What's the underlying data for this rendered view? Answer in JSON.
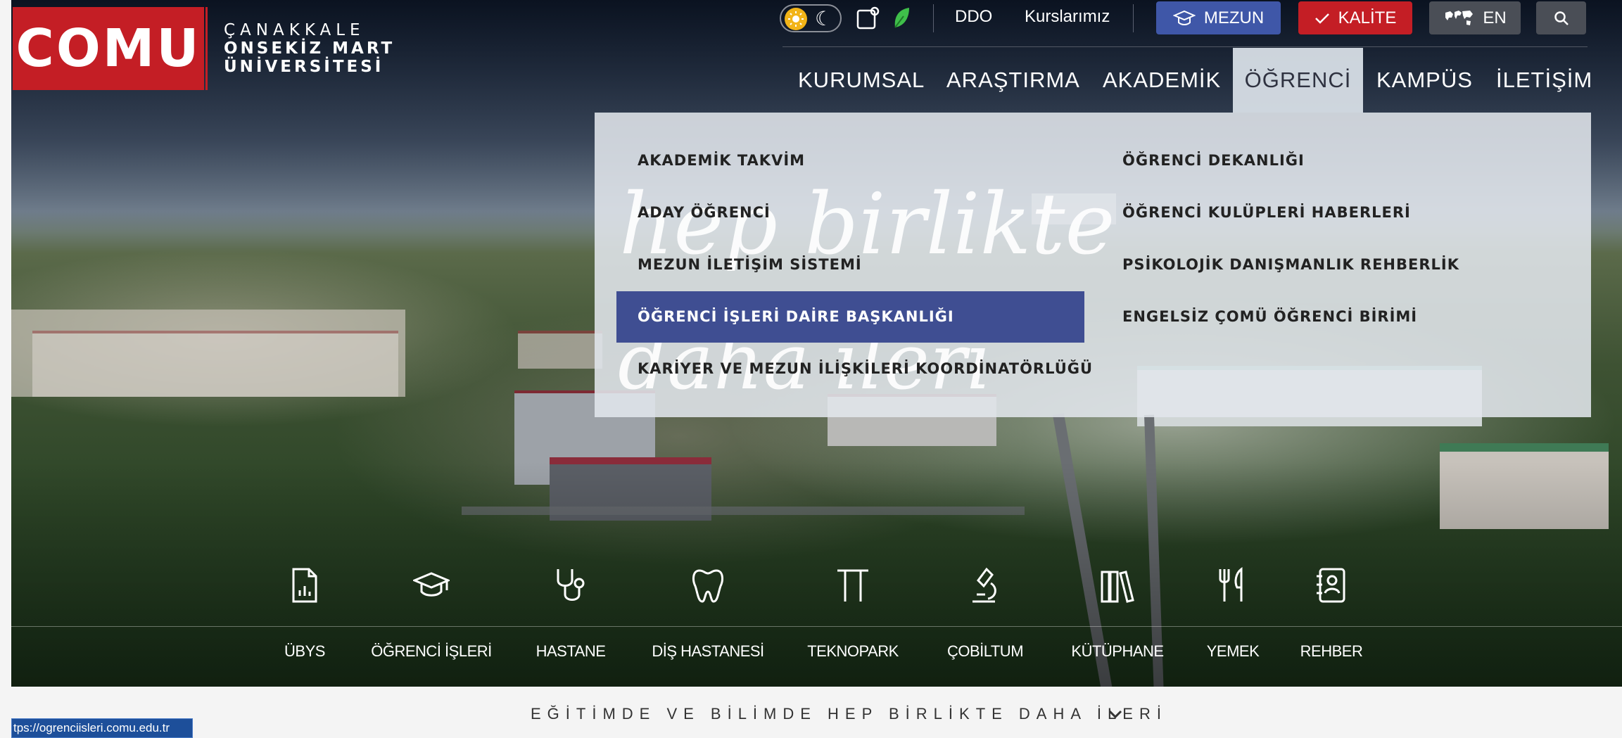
{
  "logo": {
    "abbr": "COMU"
  },
  "university": {
    "line1": "ÇANAKKALE",
    "line2": "ONSEKİZ MART",
    "line3": "ÜNİVERSİTESİ"
  },
  "topbar": {
    "ddo": "DDO",
    "courses": "Kurslarımız",
    "mezun": "MEZUN",
    "kalite": "KALİTE",
    "lang": "EN"
  },
  "nav": [
    "KURUMSAL",
    "ARAŞTIRMA",
    "AKADEMİK",
    "ÖĞRENCİ",
    "KAMPÜS",
    "İLETİŞİM"
  ],
  "nav_active": "ÖĞRENCİ",
  "menu": {
    "left": [
      "AKADEMİK TAKVİM",
      "ADAY ÖĞRENCİ",
      "MEZUN İLETİŞİM SİSTEMİ",
      "ÖĞRENCİ İŞLERİ DAİRE BAŞKANLIĞI",
      "KARİYER VE MEZUN İLİŞKİLERİ KOORDİNATÖRLÜĞÜ"
    ],
    "right": [
      "ÖĞRENCİ DEKANLIĞI",
      "ÖĞRENCİ KULÜPLERİ HABERLERİ",
      "PSİKOLOJİK DANIŞMANLIK REHBERLİK",
      "ENGELSİZ ÇOMÜ ÖĞRENCİ BİRİMİ"
    ]
  },
  "hero_script": {
    "line1": "hep birlikte",
    "line2": "daha ileri"
  },
  "quick_links": [
    {
      "label": "ÜBYS",
      "icon": "report-icon"
    },
    {
      "label": "ÖĞRENCİ İŞLERİ",
      "icon": "graduation-cap-icon"
    },
    {
      "label": "HASTANE",
      "icon": "stethoscope-icon"
    },
    {
      "label": "DİŞ HASTANESİ",
      "icon": "tooth-icon"
    },
    {
      "label": "TEKNOPARK",
      "icon": "pillar-icon"
    },
    {
      "label": "ÇOBİLTUM",
      "icon": "microscope-icon"
    },
    {
      "label": "KÜTÜPHANE",
      "icon": "books-icon"
    },
    {
      "label": "YEMEK",
      "icon": "cutlery-icon"
    },
    {
      "label": "REHBER",
      "icon": "contact-book-icon"
    }
  ],
  "slogan": "EĞİTİMDE VE BİLİMDE HEP BİRLİKTE DAHA İLERİ",
  "status_url": "tps://ogrenciisleri.comu.edu.tr",
  "colors": {
    "red": "#c41e25",
    "mezun_blue": "#3f57a8",
    "menu_selected": "#3f4e92"
  }
}
